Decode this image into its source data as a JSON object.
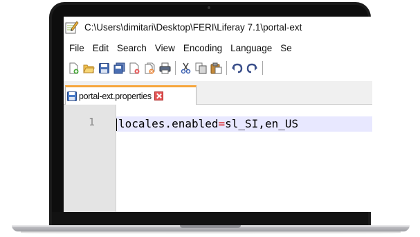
{
  "window": {
    "title": "C:\\Users\\dimitari\\Desktop\\FERI\\Liferay 7.1\\portal-ext"
  },
  "menu": {
    "items": [
      "File",
      "Edit",
      "Search",
      "View",
      "Encoding",
      "Language",
      "Se"
    ]
  },
  "toolbar": {
    "icons": [
      "new-file-icon",
      "open-folder-icon",
      "save-icon",
      "save-all-icon",
      "close-icon",
      "close-all-icon",
      "print-icon",
      "cut-icon",
      "copy-icon",
      "paste-icon",
      "undo-icon",
      "redo-icon"
    ]
  },
  "tab": {
    "label": "portal-ext.properties",
    "accent_color": "#f6a53a",
    "close_color": "#e35353"
  },
  "editor": {
    "line_number": "1",
    "key": "locales.enabled",
    "operator": "=",
    "value": "sl_SI,en_US",
    "current_line_color": "#e8e8ff",
    "operator_color": "#d30000"
  }
}
